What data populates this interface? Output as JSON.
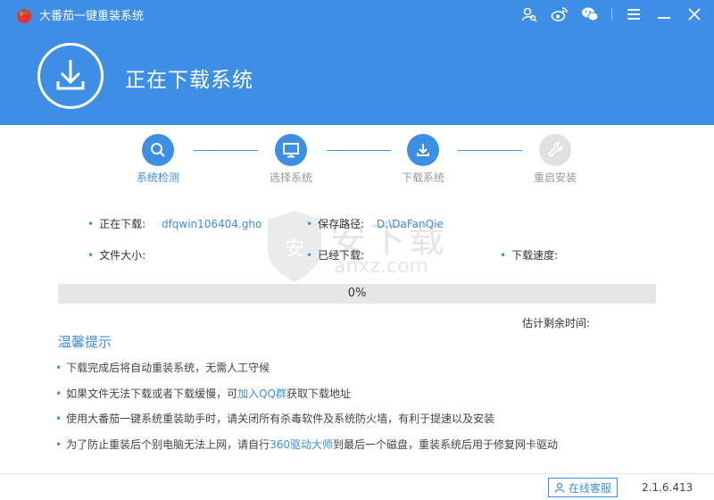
{
  "window": {
    "title": "大番茄一键重装系统",
    "icons": [
      "user-search-icon",
      "weibo-icon",
      "wechat-icon",
      "menu-icon",
      "minimize-icon",
      "close-icon"
    ]
  },
  "banner": {
    "title": "正在下载系统",
    "icon": "download-icon"
  },
  "steps": [
    {
      "label": "系统检测",
      "icon": "search-icon",
      "active": true
    },
    {
      "label": "选择系统",
      "icon": "monitor-icon",
      "active": true
    },
    {
      "label": "下载系统",
      "icon": "download-icon",
      "active": true
    },
    {
      "label": "重启安装",
      "icon": "wrench-icon",
      "active": false
    }
  ],
  "download": {
    "downloading_label": "正在下载:",
    "downloading_value": "dfqwin106404.gho",
    "save_path_label": "保存路径:",
    "save_path_value": "D:\\DaFanQie",
    "file_size_label": "文件大小:",
    "downloaded_label": "已经下载:",
    "speed_label": "下载速度:",
    "progress_text": "0%",
    "progress_percent": 0,
    "eta_label": "估计剩余时间:"
  },
  "tips": {
    "title": "温馨提示",
    "item1": "下载完成后将自动重装系统，无需人工守候",
    "item2_pre": "如果文件无法下载或者下载缓慢，可",
    "item2_link": "加入QQ群",
    "item2_post": "获取下载地址",
    "item3": "使用大番茄一键系统重装助手时，请关闭所有杀毒软件及系统防火墙，有利于提速以及安装",
    "item4_pre": "为了防止重装后个别电脑无法上网，请自行",
    "item4_link": "360驱动大师",
    "item4_post": "到最后一个磁盘，重装系统后用于修复网卡驱动"
  },
  "watermark": {
    "cn": "安下载",
    "en": "anxz.com"
  },
  "footer": {
    "service_label": "在线客服",
    "version": "2.1.6.413"
  },
  "colors": {
    "accent": "#3d8fe6",
    "step_inactive": "#dfe1e3"
  }
}
